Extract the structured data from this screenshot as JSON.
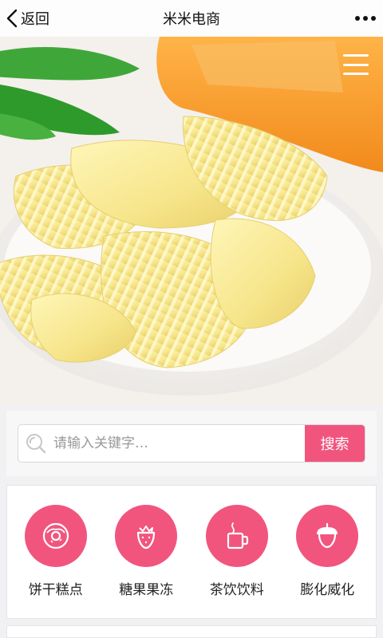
{
  "navbar": {
    "back_label": "返回",
    "title": "米米电商"
  },
  "search": {
    "placeholder": "请输入关键字…",
    "button_label": "搜索"
  },
  "categories": [
    {
      "label": "饼干糕点",
      "icon": "donut-icon"
    },
    {
      "label": "糖果果冻",
      "icon": "strawberry-icon"
    },
    {
      "label": "茶饮饮料",
      "icon": "cup-icon"
    },
    {
      "label": "膨化威化",
      "icon": "acorn-icon"
    }
  ],
  "colors": {
    "accent": "#f1557e",
    "page_bg": "#f1f1f3"
  }
}
